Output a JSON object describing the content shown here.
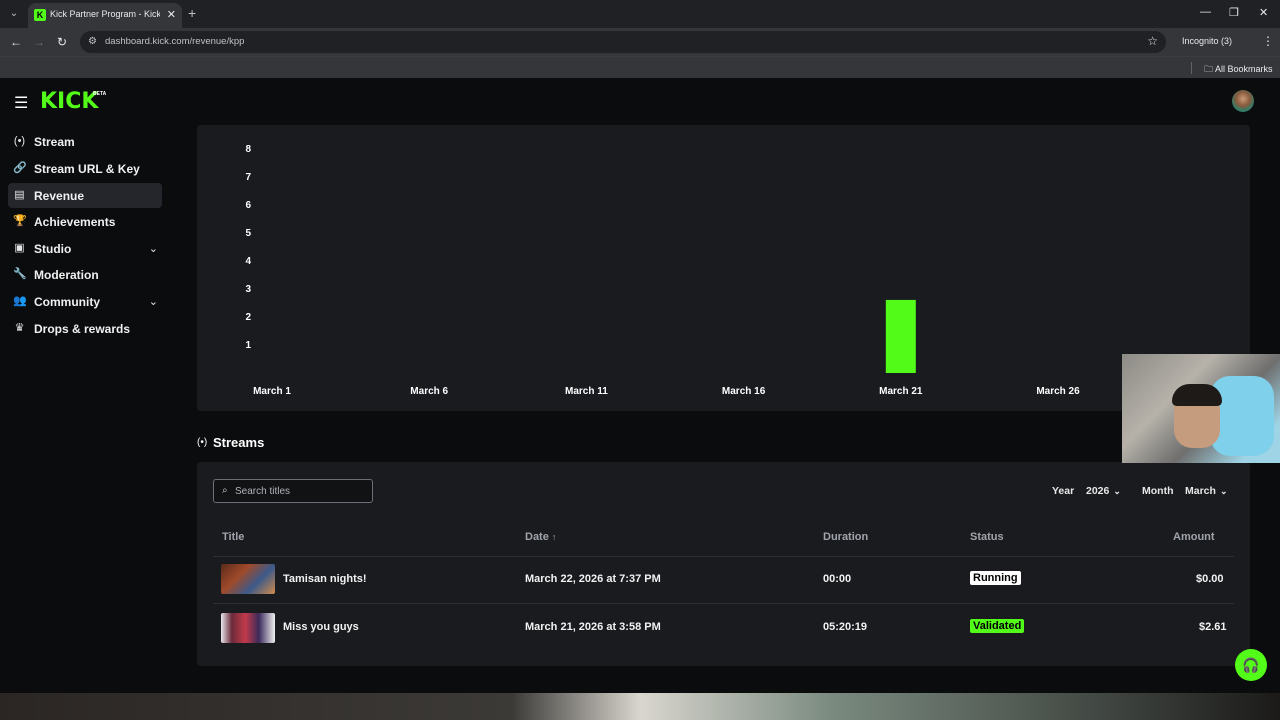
{
  "browser": {
    "tab_title": "Kick Partner Program - Kick Da",
    "url": "dashboard.kick.com/revenue/kpp",
    "incognito_label": "Incognito (3)",
    "bookmarks_label": "All Bookmarks",
    "icons": {
      "tab_favicon": "K",
      "new_tab": "+",
      "back": "←",
      "forward": "→",
      "reload": "↻",
      "close_tab": "✕",
      "minimize": "—",
      "restore": "❐",
      "close": "✕",
      "star": "☆",
      "menu": "⋮",
      "folder": "🗀",
      "site_info": "⚙"
    }
  },
  "header": {
    "logo": "KICK",
    "logo_badge": "BETA",
    "hamburger_icon": "☰"
  },
  "sidebar": {
    "items": [
      {
        "label": "Stream",
        "icon": "(•)"
      },
      {
        "label": "Stream URL & Key",
        "icon": "🔗"
      },
      {
        "label": "Revenue",
        "icon": "▤"
      },
      {
        "label": "Achievements",
        "icon": "🏆"
      },
      {
        "label": "Studio",
        "icon": "▣",
        "chevron": "⌄"
      },
      {
        "label": "Moderation",
        "icon": "🔧"
      },
      {
        "label": "Community",
        "icon": "👥",
        "chevron": "⌄"
      },
      {
        "label": "Drops & rewards",
        "icon": "♛"
      }
    ]
  },
  "chart_data": {
    "type": "bar",
    "x_tick_labels": [
      "March 1",
      "March 6",
      "March 11",
      "March 16",
      "March 21",
      "March 26"
    ],
    "y_tick_labels": [
      "1",
      "2",
      "3",
      "4",
      "5",
      "6",
      "7",
      "8"
    ],
    "categories": [
      "March 21"
    ],
    "values": [
      2.61
    ],
    "ylim": [
      0,
      8
    ],
    "bar_color": "#53fc18",
    "grid": false
  },
  "streams": {
    "heading": "Streams",
    "heading_icon": "(•)",
    "search_placeholder": "Search titles",
    "search_icon": "⌕",
    "year_label": "Year",
    "year_value": "2026",
    "month_label": "Month",
    "month_value": "March",
    "columns": {
      "title": "Title",
      "date": "Date",
      "date_sort_icon": "↑",
      "duration": "Duration",
      "status": "Status",
      "amount": "Amount"
    },
    "rows": [
      {
        "title": "Tamisan nights!",
        "date": "March 22, 2026 at 7:37 PM",
        "duration": "00:00",
        "status": "Running",
        "amount": "$0.00"
      },
      {
        "title": "Miss you guys",
        "date": "March 21, 2026 at 3:58 PM",
        "duration": "05:20:19",
        "status": "Validated",
        "amount": "$2.61"
      }
    ]
  },
  "support_icon": "🎧"
}
